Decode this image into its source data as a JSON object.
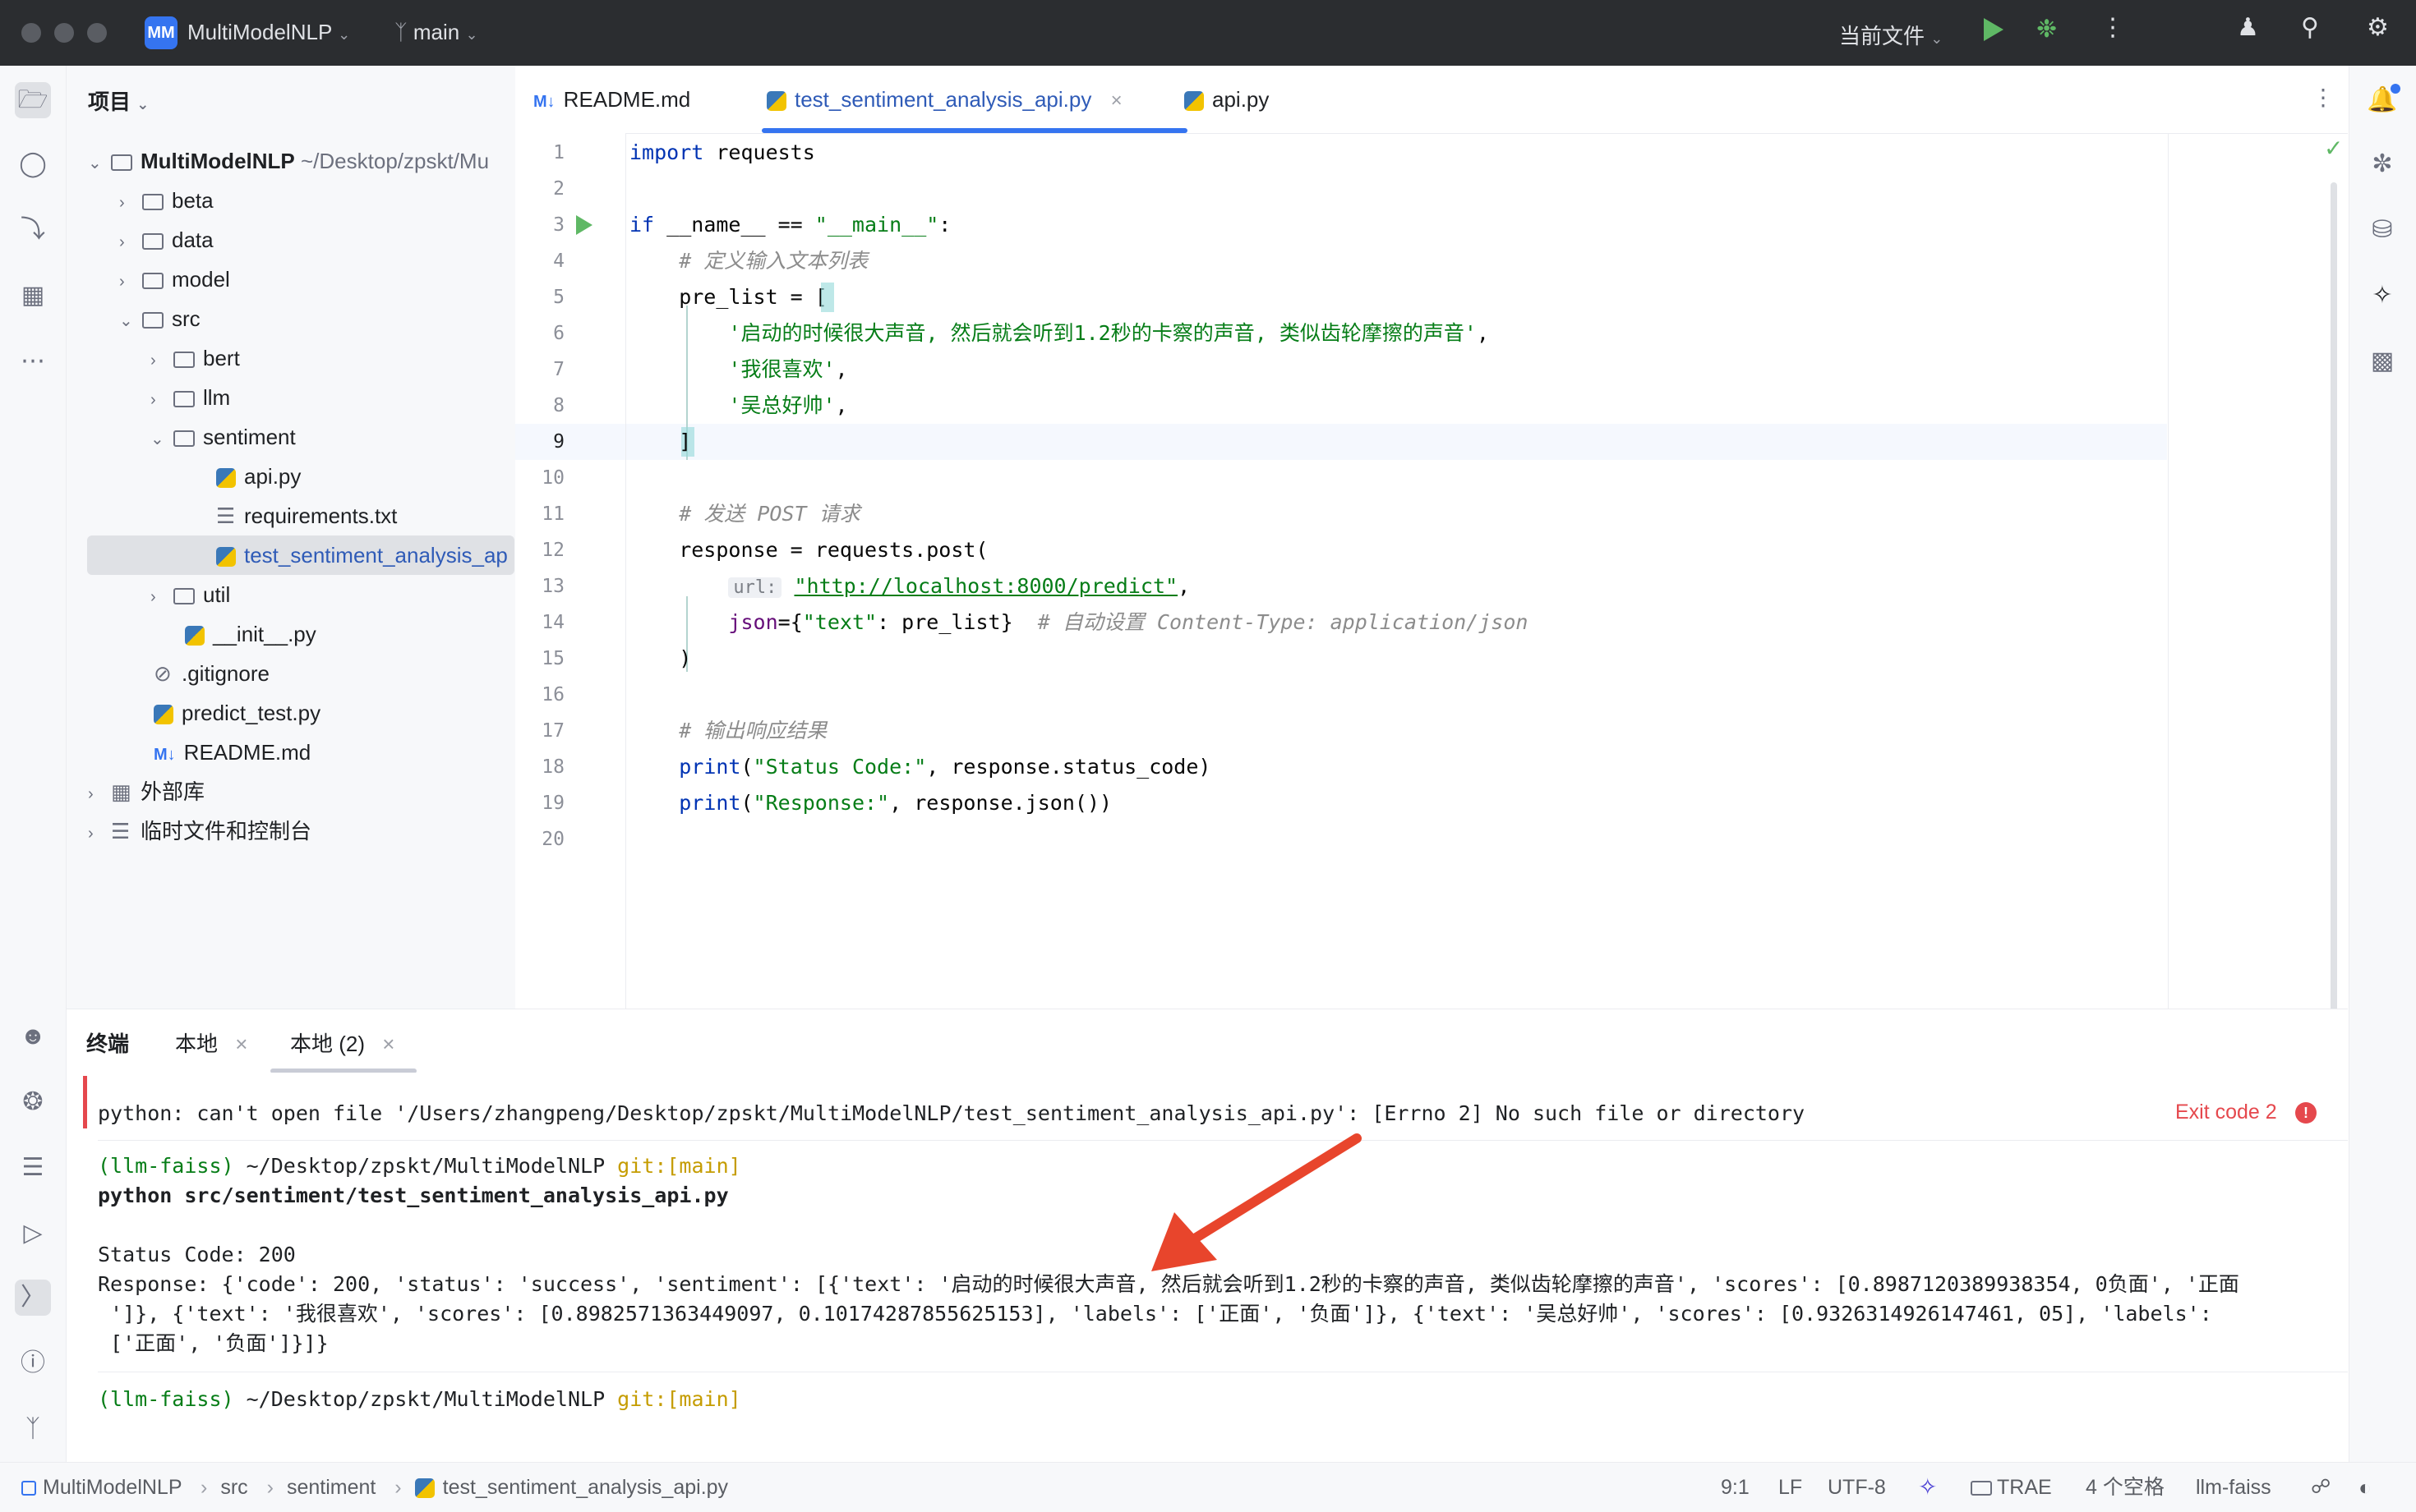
{
  "titlebar": {
    "project_badge": "MM",
    "project_name": "MultiModelNLP",
    "branch": "main",
    "run_config": "当前文件"
  },
  "project_panel": {
    "title": "项目",
    "root_name": "MultiModelNLP",
    "root_path": "~/Desktop/zpskt/Mu",
    "items": [
      {
        "label": "beta"
      },
      {
        "label": "data"
      },
      {
        "label": "model"
      },
      {
        "label": "src"
      },
      {
        "label": "bert"
      },
      {
        "label": "llm"
      },
      {
        "label": "sentiment"
      },
      {
        "label": "api.py"
      },
      {
        "label": "requirements.txt"
      },
      {
        "label": "test_sentiment_analysis_ap"
      },
      {
        "label": "util"
      },
      {
        "label": "__init__.py"
      },
      {
        "label": ".gitignore"
      },
      {
        "label": "predict_test.py"
      },
      {
        "label": "README.md"
      },
      {
        "label": "外部库"
      },
      {
        "label": "临时文件和控制台"
      }
    ]
  },
  "editor": {
    "tabs": [
      {
        "label": "README.md",
        "icon_text": "M↓"
      },
      {
        "label": "test_sentiment_analysis_api.py"
      },
      {
        "label": "api.py"
      }
    ],
    "line_numbers": [
      "1",
      "2",
      "3",
      "4",
      "5",
      "6",
      "7",
      "8",
      "9",
      "10",
      "11",
      "12",
      "13",
      "14",
      "15",
      "16",
      "17",
      "18",
      "19",
      "20"
    ],
    "code": {
      "l1a": "import",
      "l1b": " requests",
      "l3a": "if",
      "l3b": " __name__ == ",
      "l3c": "\"__main__\"",
      "l3d": ":",
      "l4": "    # 定义输入文本列表",
      "l5a": "    pre_list = [",
      "l6": "        '启动的时候很大声音, 然后就会听到1.2秒的卡察的声音, 类似齿轮摩擦的声音'",
      "l6b": ",",
      "l7": "        '我很喜欢'",
      "l7b": ",",
      "l8": "        '吴总好帅'",
      "l8b": ",",
      "l9": "    ]",
      "l11a": "    # 发送 ",
      "l11b": "POST",
      "l11c": " 请求",
      "l12a": "    response = requests.post(",
      "l13hint": "url:",
      "l13url": "\"http://localhost:8000/predict\"",
      "l13b": ",",
      "l14a": "json",
      "l14b": "={",
      "l14c": "\"text\"",
      "l14d": ": pre_list}  ",
      "l14e": "# 自动设置 Content-Type: application/json",
      "l15": "    )",
      "l17": "    # 输出响应结果",
      "l18a": "print",
      "l18b": "(",
      "l18c": "\"Status Code:\"",
      "l18d": ", response.status_code)",
      "l19a": "print",
      "l19b": "(",
      "l19c": "\"Response:\"",
      "l19d": ", response.json())"
    }
  },
  "terminal": {
    "title": "终端",
    "tabs": [
      "本地",
      "本地 (2)"
    ],
    "error_line": "python: can't open file '/Users/zhangpeng/Desktop/zpskt/MultiModelNLP/test_sentiment_analysis_api.py': [Errno 2] No such file or directory",
    "exit_code": "Exit code 2",
    "prompt_env": "(llm-faiss)",
    "prompt_path": " ~/Desktop/zpskt/MultiModelNLP ",
    "prompt_git": "git:[main]",
    "command": "python src/sentiment/test_sentiment_analysis_api.py",
    "output_status": "Status Code: 200",
    "output_response_1": "Response: {'code': 200, 'status': 'success', 'sentiment': [{'text': '启动的时候很大声音, 然后就会听到1.2秒的卡察的声音, 类似齿轮摩擦的声音', 'scores': [0.8987120389938354, 0负面', '正面",
    "output_response_2": " ']}, {'text': '我很喜欢', 'scores': [0.8982571363449097, 0.10174287855625153], 'labels': ['正面', '负面']}, {'text': '吴总好帅', 'scores': [0.9326314926147461, 05], 'labels':",
    "output_response_3": " ['正面', '负面']}]}"
  },
  "statusbar": {
    "breadcrumbs": [
      "MultiModelNLP",
      "src",
      "sentiment",
      "test_sentiment_analysis_api.py"
    ],
    "position": "9:1",
    "line_sep": "LF",
    "encoding": "UTF-8",
    "trae": "TRAE",
    "indent": "4 个空格",
    "interpreter": "llm-faiss"
  },
  "colors": {
    "accent": "#3574f0",
    "error": "#e5484d",
    "arrow": "#e8452c",
    "titlebar_bg": "#2b2d30"
  }
}
